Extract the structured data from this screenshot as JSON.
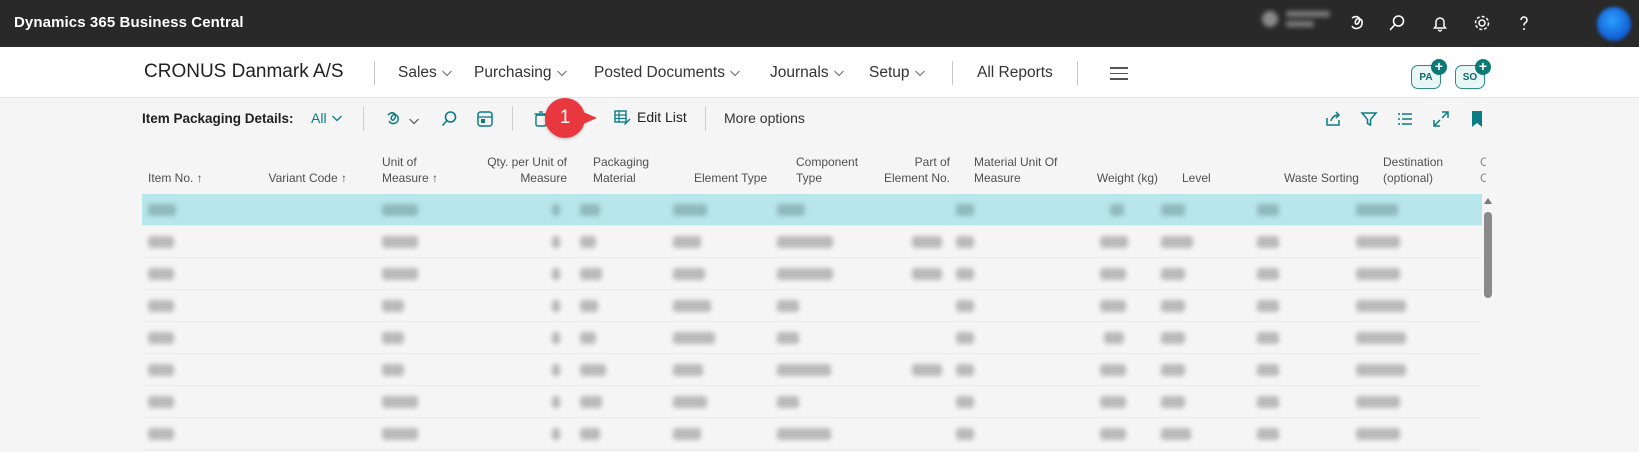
{
  "topbar": {
    "app_title": "Dynamics 365 Business Central",
    "icons": [
      "copilot-icon",
      "search-icon",
      "bell-icon",
      "gear-icon",
      "help-icon",
      "avatar"
    ]
  },
  "navbar": {
    "company": "CRONUS Danmark A/S",
    "items": [
      {
        "label": "Sales"
      },
      {
        "label": "Purchasing"
      },
      {
        "label": "Posted Documents"
      },
      {
        "label": "Journals"
      },
      {
        "label": "Setup"
      }
    ],
    "all_reports": "All Reports",
    "roles": [
      {
        "label": "PA"
      },
      {
        "label": "SO"
      }
    ]
  },
  "actionbar": {
    "title": "Item Packaging Details:",
    "view": "All",
    "edit_list": "Edit List",
    "more_options": "More options",
    "callout_number": "1"
  },
  "grid": {
    "columns": [
      {
        "label": "Item No. ↑"
      },
      {
        "label": "Variant Code ↑"
      },
      {
        "label": "Unit of Measure ↑"
      },
      {
        "label": "Qty. per Unit of Measure"
      },
      {
        "label": "Packaging Material"
      },
      {
        "label": "Element Type"
      },
      {
        "label": "Component Type"
      },
      {
        "label": "Part of Element No."
      },
      {
        "label": "Material Unit Of Measure"
      },
      {
        "label": "Weight (kg)"
      },
      {
        "label": "Level"
      },
      {
        "label": "Waste Sorting"
      },
      {
        "label": "Destination (optional)"
      }
    ]
  },
  "colors": {
    "topbar": "#292929",
    "accent": "#0a7c83",
    "selected_row": "#b7e7ea",
    "callout": "#e8373e"
  }
}
